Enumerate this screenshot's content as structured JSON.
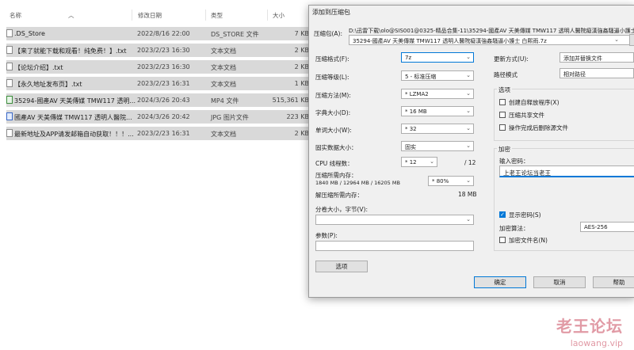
{
  "explorer": {
    "columns": {
      "name": "名称",
      "date": "修改日期",
      "type": "类型",
      "size": "大小"
    },
    "files": [
      {
        "name": ".DS_Store",
        "date": "2022/8/16 22:00",
        "type": "DS_STORE 文件",
        "size": "7 KB",
        "icon": "file-icon"
      },
      {
        "name": "【来了就能下载和观看！纯免费！】.txt",
        "date": "2023/2/23 16:30",
        "type": "文本文档",
        "size": "2 KB",
        "icon": "text-file-icon"
      },
      {
        "name": "【论坛介绍】.txt",
        "date": "2023/2/23 16:30",
        "type": "文本文档",
        "size": "2 KB",
        "icon": "text-file-icon"
      },
      {
        "name": "【永久地址发布页】.txt",
        "date": "2023/2/23 16:31",
        "type": "文本文档",
        "size": "1 KB",
        "icon": "text-file-icon"
      },
      {
        "name": "35294-國產AV 天美傳媒 TMW117 透明...",
        "date": "2024/3/26 20:43",
        "type": "MP4 文件",
        "size": "515,361 KB",
        "icon": "video-file-icon"
      },
      {
        "name": "國產AV 天美傳媒 TMW117 透明人醫院...",
        "date": "2024/3/26 20:42",
        "type": "JPG 图片文件",
        "size": "223 KB",
        "icon": "image-file-icon"
      },
      {
        "name": "最新地址及APP请发邮箱自动获取！！！...",
        "date": "2023/2/23 16:31",
        "type": "文本文档",
        "size": "2 KB",
        "icon": "text-file-icon"
      }
    ]
  },
  "dialog": {
    "title": "添加到压缩包",
    "archive_label": "压缩包(A):",
    "archive_dir": "D:\\迅雷下载\\olo@SIS001@0325-精品合集-11\\35294-國產AV 天美傳媒 TMW117 透明人醫院癡漢強姦騷逼小護士",
    "archive_name": "35294-國產AV 天美傳媒 TMW117 透明人醫院癡漢強姦騷逼小護士 白熙雨.7z",
    "format_label": "压缩格式(F):",
    "format_value": "7z",
    "level_label": "压缩等级(L):",
    "level_value": "5 - 标准压缩",
    "method_label": "压缩方法(M):",
    "method_value": "* LZMA2",
    "dict_label": "字典大小(D):",
    "dict_value": "* 16 MB",
    "word_label": "单词大小(W):",
    "word_value": "* 32",
    "solid_label": "固实数据大小：",
    "solid_value": "固实",
    "cpu_label": "CPU 线程数：",
    "cpu_value": "* 12",
    "cpu_total": "/ 12",
    "mem_comp_label": "压缩所需内存：",
    "mem_comp_value": "1840 MB / 12964 MB / 16205 MB",
    "mem_comp_percent": "* 80%",
    "mem_decomp_label": "解压缩所需内存：",
    "mem_decomp_value": "18 MB",
    "split_label": "分卷大小，字节(V):",
    "params_label": "参数(P):",
    "options_button": "选项",
    "update_label": "更新方式(U):",
    "update_value": "添加并替换文件",
    "pathmode_label": "路径模式",
    "pathmode_value": "相对路径",
    "options_group": "选项",
    "opt_sfx": "创建自释放程序(X)",
    "opt_shared": "压缩共享文件",
    "opt_delete": "操作完成后删除源文件",
    "encrypt_group": "加密",
    "pw_label": "输入密码：",
    "pw_value": "上老王论坛当老王",
    "show_pw": "显示密码(S)",
    "enc_method_label": "加密算法：",
    "enc_method_value": "AES-256",
    "enc_names": "加密文件名(N)",
    "ok": "确定",
    "cancel": "取消",
    "help": "帮助"
  },
  "watermark": {
    "line1": "老王论坛",
    "line2": "laowang.vip"
  }
}
